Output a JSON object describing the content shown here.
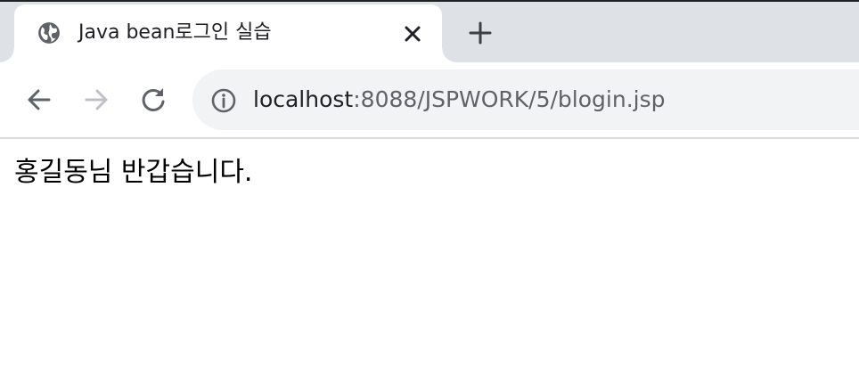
{
  "browser": {
    "tab": {
      "title": "Java bean로그인 실습",
      "favicon": "globe-icon",
      "close_icon": "close-icon"
    },
    "new_tab_icon": "plus-icon",
    "toolbar": {
      "back_icon": "arrow-left-icon",
      "forward_icon": "arrow-right-icon",
      "reload_icon": "reload-icon",
      "forward_enabled": false
    },
    "address_bar": {
      "info_icon": "info-icon",
      "host": "localhost",
      "path": ":8088/JSPWORK/5/blogin.jsp"
    },
    "colors": {
      "tabstrip": "#dee1e6",
      "omnibox": "#f1f3f4",
      "icon": "#5f6368",
      "disabled_icon": "#bdc1c6"
    }
  },
  "page": {
    "message": "홍길동님 반갑습니다."
  }
}
